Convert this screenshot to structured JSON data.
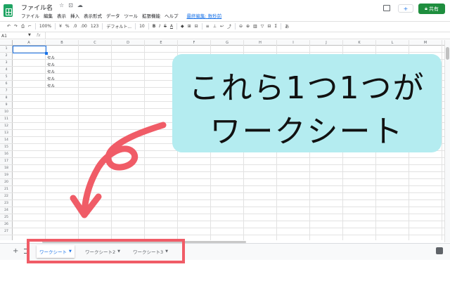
{
  "header": {
    "doc_title": "ファイル名",
    "title_icons": [
      "☆",
      "⊡",
      "☁"
    ],
    "menu": [
      "ファイル",
      "編集",
      "表示",
      "挿入",
      "表示形式",
      "データ",
      "ツール",
      "拡張機能",
      "ヘルプ"
    ],
    "last_edit": "最終編集: 数秒前",
    "present_label": "+",
    "share_label": "共有"
  },
  "toolbar": {
    "undo": "↶",
    "redo": "↷",
    "print": "⎙",
    "paint": "⌐",
    "zoom": "100%",
    "currency": "¥",
    "percent": "%",
    "dec_dec": ".0",
    "dec_inc": ".00",
    "more_formats": "123",
    "font": "デフォルト...",
    "font_size": "10",
    "bold": "B",
    "italic": "I",
    "strike": "S",
    "text_color": "A",
    "fill": "◆",
    "borders": "⊞",
    "merge": "⊟",
    "halign": "≡",
    "valign": "⊥",
    "wrap": "↩",
    "rotate": "⤴",
    "link": "⊖",
    "comment": "⊕",
    "chart": "▥",
    "filter": "▽",
    "views": "⊟",
    "functions": "Σ",
    "input_tools": "あ"
  },
  "formula_bar": {
    "cell_ref": "A1",
    "fx": "fx",
    "content": ""
  },
  "grid": {
    "columns": [
      "A",
      "B",
      "C",
      "D",
      "E",
      "F",
      "G",
      "H",
      "I",
      "J",
      "K",
      "L",
      "M"
    ],
    "rows": [
      "1",
      "2",
      "3",
      "4",
      "5",
      "6",
      "7",
      "8",
      "9",
      "10",
      "11",
      "12",
      "13",
      "14",
      "15",
      "16",
      "17",
      "18",
      "19",
      "20",
      "21",
      "22",
      "23",
      "24",
      "25",
      "26",
      "27"
    ],
    "cells": {
      "B2": "セル",
      "B3": "セル",
      "B4": "セル",
      "B5": "セル",
      "B6": "セル"
    }
  },
  "callout": {
    "line1": "これら1つ1つが",
    "line2": "ワークシート"
  },
  "sheet_bar": {
    "add": "+",
    "tabs": [
      {
        "label": "ワークシート",
        "active": true
      },
      {
        "label": "ワークシート2",
        "active": false
      },
      {
        "label": "ワークシート3",
        "active": false
      }
    ]
  },
  "colors": {
    "callout_bg": "#b4ecf0",
    "arrow": "#f05c67",
    "share": "#1e8e3e",
    "accent": "#1a73e8"
  }
}
